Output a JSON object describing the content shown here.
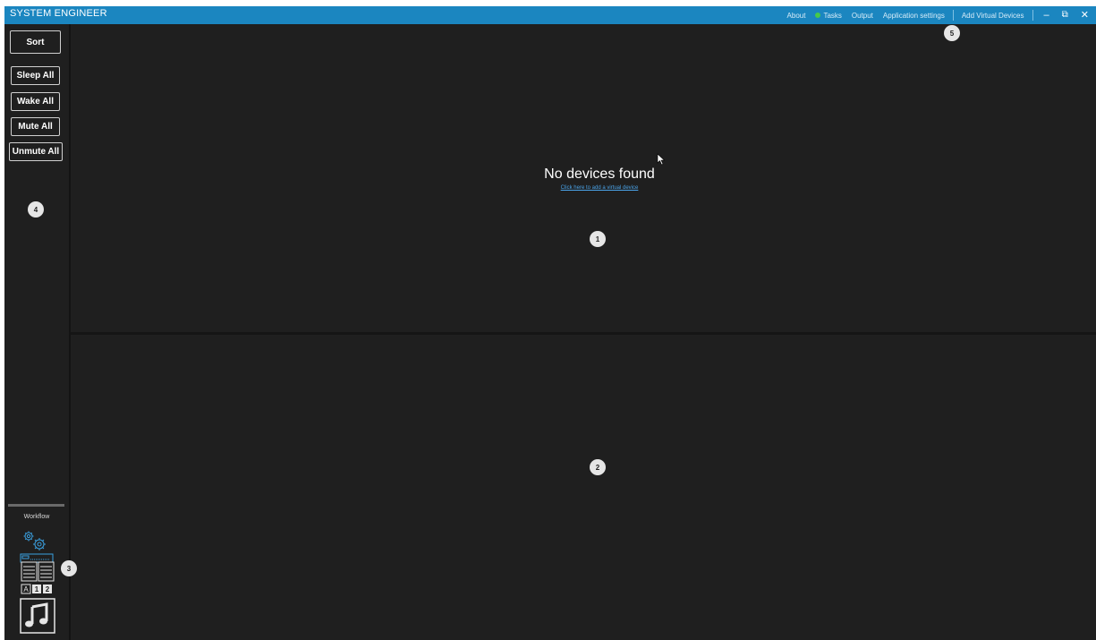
{
  "window": {
    "title": "SYSTEM ENGINEER",
    "accent": "#1b86c0",
    "background": "#1f1f1f"
  },
  "menu": {
    "about": "About",
    "tasks": "Tasks",
    "tasks_status_color": "#47c94a",
    "output": "Output",
    "settings": "Application settings",
    "add_virtual": "Add Virtual Devices",
    "minimize": "–",
    "restore": "⧉",
    "close": "✕"
  },
  "sidebar": {
    "sort": "Sort",
    "sleep_all": "Sleep All",
    "wake_all": "Wake All",
    "mute_all": "Mute All",
    "unmute_all": "Unmute All",
    "workflow_label": "Workflow",
    "workflow_icons": [
      "gears-device-icon",
      "ab-list-icon",
      "music-note-icon"
    ],
    "list_icon_labels": [
      "A",
      "1",
      "2"
    ]
  },
  "main": {
    "empty_title": "No devices found",
    "empty_link": "Click here to add a virtual device"
  },
  "markers": [
    "1",
    "2",
    "3",
    "4",
    "5"
  ]
}
